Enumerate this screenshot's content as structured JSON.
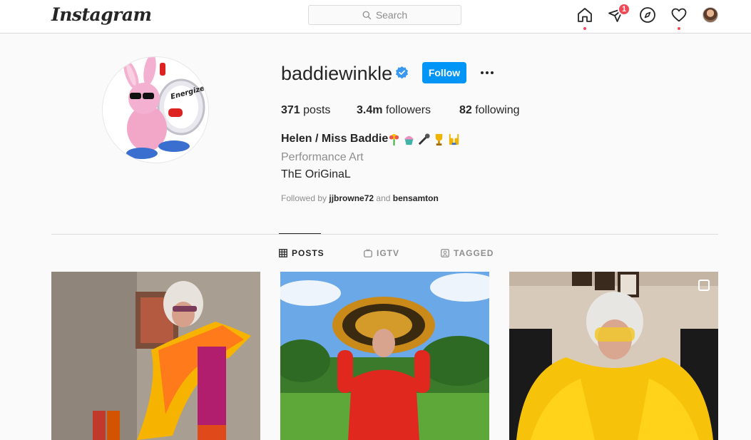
{
  "app": {
    "logo_text": "Instagram"
  },
  "search": {
    "placeholder": "Search"
  },
  "nav": {
    "home_icon": "home-icon",
    "direct_icon": "direct-icon",
    "direct_badge": "1",
    "explore_icon": "compass-icon",
    "activity_icon": "heart-icon"
  },
  "profile": {
    "username": "baddiewinkle",
    "follow_label": "Follow",
    "posts_count": "371",
    "posts_label": "posts",
    "followers_count": "3.4m",
    "followers_label": "followers",
    "following_count": "82",
    "following_label": "following",
    "full_name": "Helen / Miss Baddie",
    "category": "Performance Art",
    "bio": "ThE OriGinaL",
    "followed_by_prefix": "Followed by",
    "followed_by_user1": "jjbrowne72",
    "followed_by_and": "and",
    "followed_by_user2": "bensamton",
    "profile_pic_text": "Energizer"
  },
  "tabs": [
    {
      "label": "POSTS",
      "active": true
    },
    {
      "label": "IGTV",
      "active": false
    },
    {
      "label": "TAGGED",
      "active": false
    }
  ],
  "colors": {
    "accent": "#0095f6",
    "notification": "#ed4956",
    "border": "#dbdbdb",
    "muted": "#8e8e8e"
  }
}
